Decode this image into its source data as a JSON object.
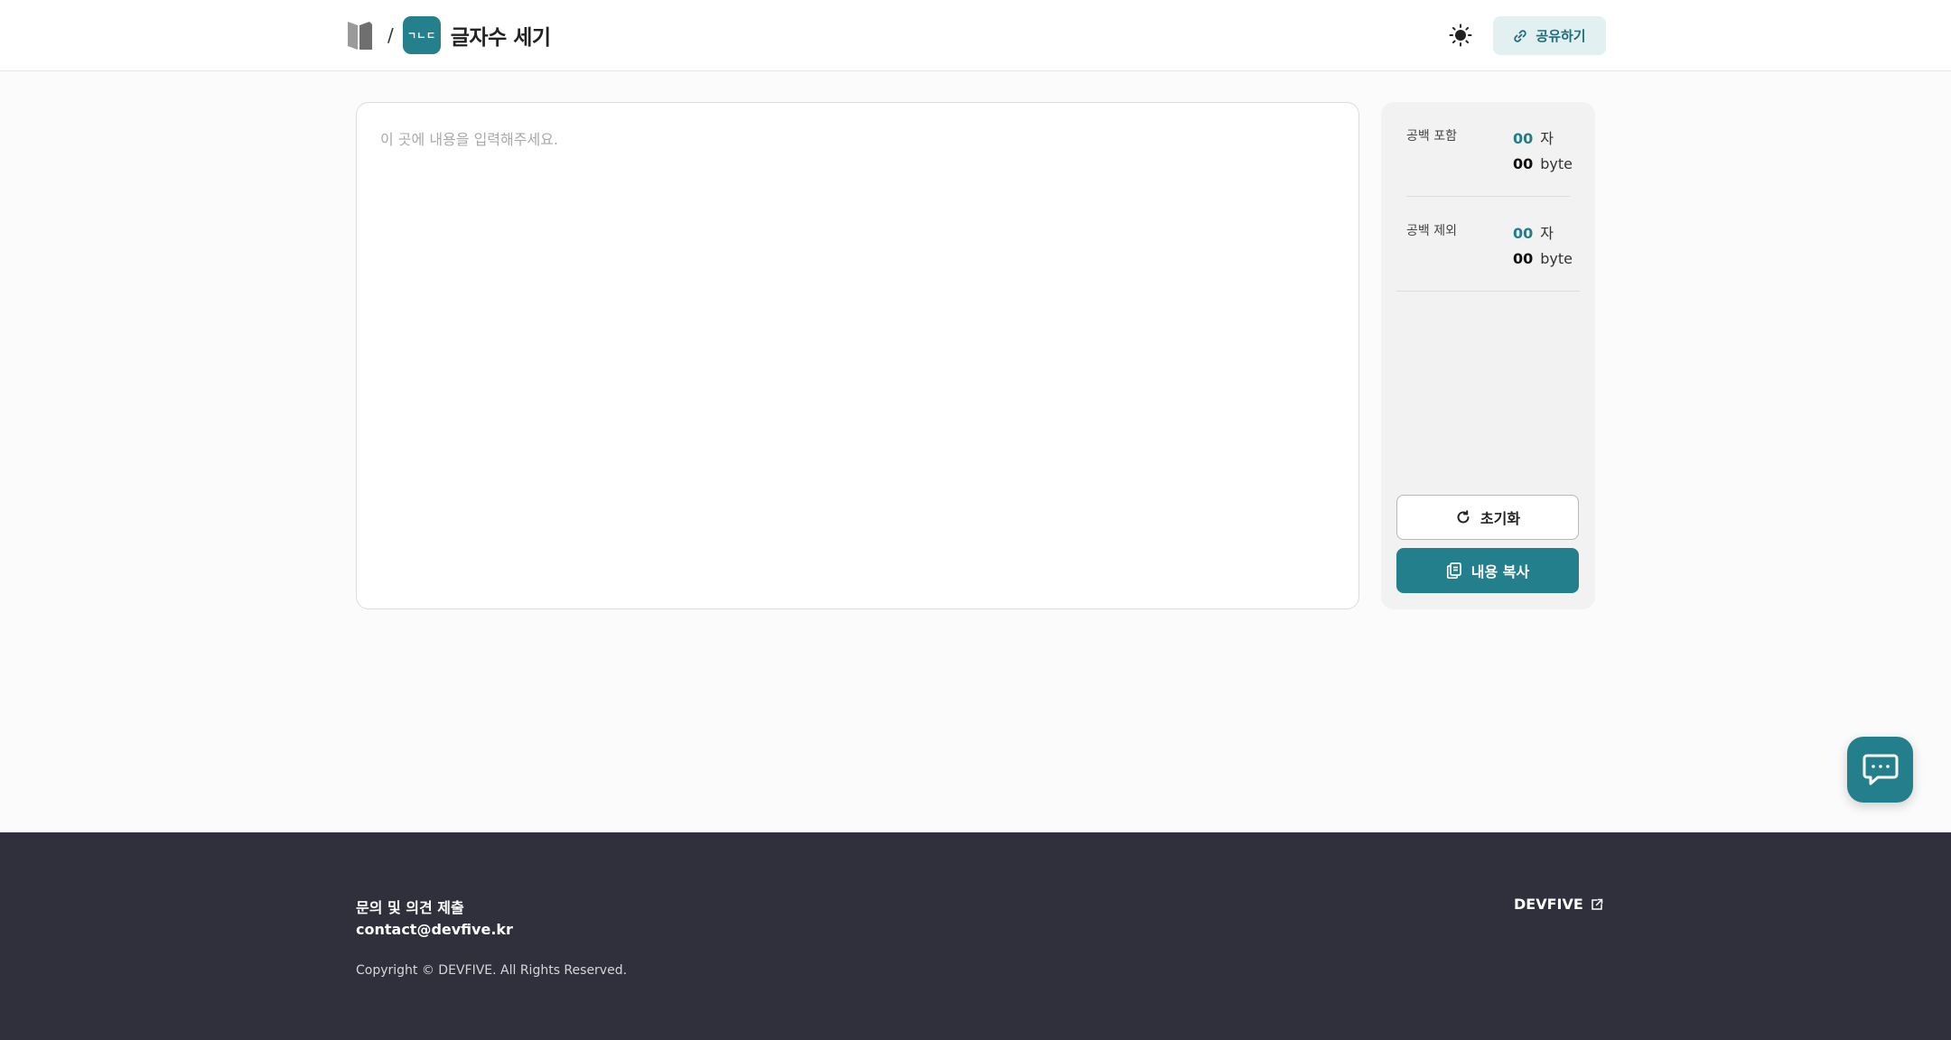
{
  "header": {
    "separator": "/",
    "app_logo_text": "ㄱㄴㄷ",
    "app_title": "글자수 세기",
    "share_label": "공유하기"
  },
  "editor": {
    "placeholder": "이 곳에 내용을 입력해주세요.",
    "value": ""
  },
  "stats": {
    "with_spaces": {
      "label": "공백 포함",
      "chars": "00",
      "chars_unit": "자",
      "bytes": "00",
      "bytes_unit": "byte"
    },
    "without_spaces": {
      "label": "공백 제외",
      "chars": "00",
      "chars_unit": "자",
      "bytes": "00",
      "bytes_unit": "byte"
    }
  },
  "actions": {
    "reset_label": "초기화",
    "copy_label": "내용 복사"
  },
  "footer": {
    "inquiry_label": "문의 및 의견 제출",
    "email": "contact@devfive.kr",
    "copyright": "Copyright © DEVFIVE. All Rights Reserved.",
    "company_link": "DEVFIVE"
  },
  "colors": {
    "accent": "#237f8b",
    "accent_light": "#e3f0f2",
    "footer_bg": "#2f303b",
    "page_bg": "#fbfbfb"
  },
  "icons": [
    "brand-book-icon",
    "sun-icon",
    "link-icon",
    "refresh-icon",
    "copy-icon",
    "chat-icon",
    "external-link-icon"
  ]
}
